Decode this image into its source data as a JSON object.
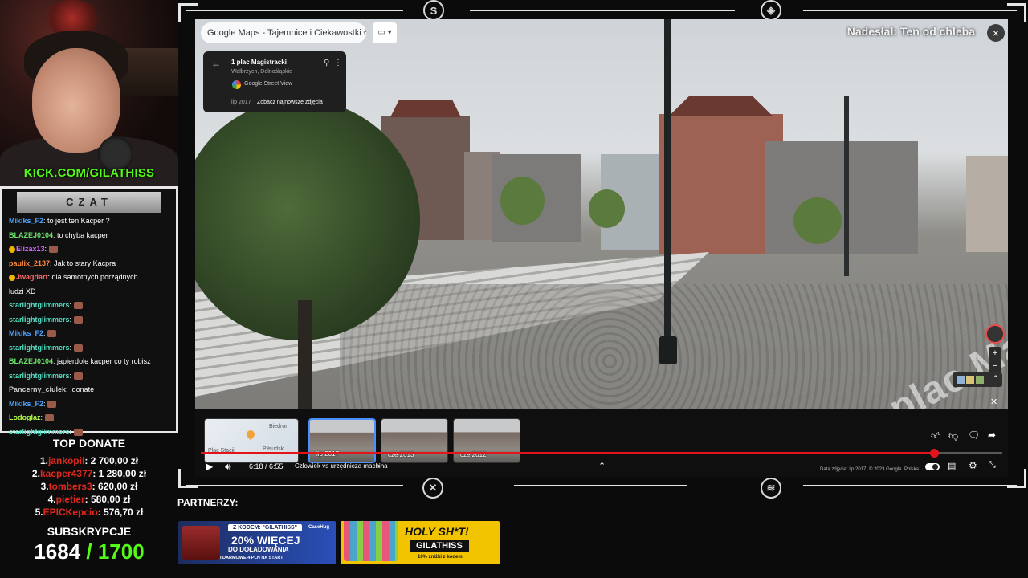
{
  "stream": {
    "kick_url_prefix": "KICK.COM/",
    "kick_url_name": "GILATHISS",
    "chat_title": "CZAT",
    "chat": [
      {
        "user": "Mikiks_F2",
        "color": "#4aa3ff",
        "text": "to jest ten Kacper ?",
        "emote": false
      },
      {
        "user": "BLAZEJ0104",
        "color": "#6be06b",
        "text": "to chyba kacper",
        "emote": false
      },
      {
        "user": "Elizax13",
        "color": "#d46bff",
        "text": "",
        "emote": true
      },
      {
        "user": "paulix_2137",
        "color": "#ff8a3d",
        "text": "Jak to stary Kacpra",
        "emote": false
      },
      {
        "user": "Jwagdart",
        "color": "#ff6b6b",
        "text": "dla samotnych porządnych",
        "emote": false
      },
      {
        "user": "",
        "color": "#fff",
        "text": "ludzi XD",
        "emote": false
      },
      {
        "user": "starlightglimmers",
        "color": "#52e0c4",
        "text": "",
        "emote": true
      },
      {
        "user": "starlightglimmers",
        "color": "#52e0c4",
        "text": "",
        "emote": true
      },
      {
        "user": "Mikiks_F2",
        "color": "#4aa3ff",
        "text": "",
        "emote": true
      },
      {
        "user": "starlightglimmers",
        "color": "#52e0c4",
        "text": "",
        "emote": true
      },
      {
        "user": "BLAZEJ0104",
        "color": "#6be06b",
        "text": "japierdole kacper co ty robisz",
        "emote": false
      },
      {
        "user": "starlightglimmers",
        "color": "#52e0c4",
        "text": "",
        "emote": true
      },
      {
        "user": "Pancerny_ciulek",
        "color": "#cfcfcf",
        "text": "!donate",
        "emote": false
      },
      {
        "user": "Mikiks_F2",
        "color": "#4aa3ff",
        "text": "",
        "emote": true
      },
      {
        "user": "Lodoglaz",
        "color": "#b6ff4a",
        "text": "",
        "emote": true
      },
      {
        "user": "starlightglimmers",
        "color": "#52e0c4",
        "text": "",
        "emote": true
      }
    ],
    "top_donate_title": "TOP DONATE",
    "top_donate": [
      {
        "rank": "1.",
        "name": "jankopil",
        "amount": "2 700,00 zł"
      },
      {
        "rank": "2.",
        "name": "kacper4377",
        "amount": "1 280,00 zł"
      },
      {
        "rank": "3.",
        "name": "tombers3",
        "amount": "620,00 zł"
      },
      {
        "rank": "4.",
        "name": "pietier",
        "amount": "580,00 zł"
      },
      {
        "rank": "5.",
        "name": "EPICKepcio",
        "amount": "576,70 zł"
      }
    ],
    "subs_title": "SUBSKRYPCJE",
    "subs_current": "1684",
    "subs_goal": "/ 1700",
    "partners_title": "PARTNERZY:"
  },
  "map": {
    "tab_pill": "Google Maps - Tajemnice i Ciekawostki 67",
    "sender": "Nadesłał: Ten od chleba",
    "close": "×",
    "card": {
      "title": "1 plac Magistracki",
      "subtitle": "Wałbrzych, Dolnośląskie",
      "source": "Google Street View",
      "date": "lip 2017",
      "newest": "Zobacz najnowsze zdjęcia"
    },
    "street_name": "plac Magistracki",
    "zoom_in": "+",
    "zoom_out": "−"
  },
  "player": {
    "thumbs": [
      {
        "label": "",
        "map_labels": [
          "Biedron",
          "Piłsudsk",
          "Plac Stacji"
        ]
      },
      {
        "label": "lip 2017"
      },
      {
        "label": "cze 2013"
      },
      {
        "label": "cze 2012"
      }
    ],
    "time": "6:18 / 6:55",
    "chapter": "Człowiek vs urzędnicza machina",
    "image_date": "Data zdjęcia: lip 2017",
    "copyright": "© 2023 Google",
    "country": "Polska",
    "progress": 0.915,
    "progress_color": "#e4151a"
  },
  "banners": {
    "case": {
      "code": "Z KODEM: \"GILATHISS\"",
      "brand": "CaseHug",
      "big": "20% WIĘCEJ",
      "mid": "DO DOŁADOWANIA",
      "small": "I DARMOWE 4 PLN NA START"
    },
    "holy": {
      "title": "HOLY SH*T!",
      "code": "GILATHISS",
      "sub": "10% zniżki z kodem"
    }
  }
}
